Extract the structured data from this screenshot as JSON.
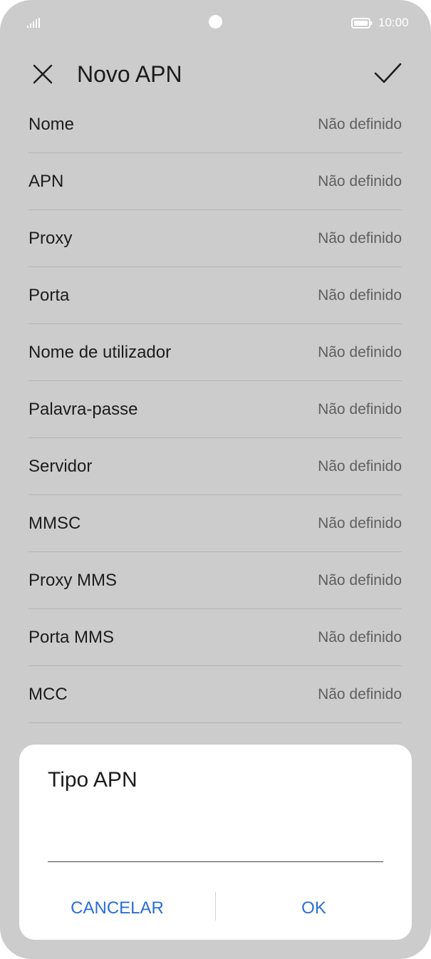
{
  "status_bar": {
    "time": "10:00",
    "signal_icon": "signal-icon",
    "battery_icon": "battery-icon"
  },
  "header": {
    "title": "Novo APN",
    "close_icon": "close-icon",
    "confirm_icon": "check-icon"
  },
  "fields": [
    {
      "label": "Nome",
      "value": "Não definido"
    },
    {
      "label": "APN",
      "value": "Não definido"
    },
    {
      "label": "Proxy",
      "value": "Não definido"
    },
    {
      "label": "Porta",
      "value": "Não definido"
    },
    {
      "label": "Nome de utilizador",
      "value": "Não definido"
    },
    {
      "label": "Palavra-passe",
      "value": "Não definido"
    },
    {
      "label": "Servidor",
      "value": "Não definido"
    },
    {
      "label": "MMSC",
      "value": "Não definido"
    },
    {
      "label": "Proxy MMS",
      "value": "Não definido"
    },
    {
      "label": "Porta MMS",
      "value": "Não definido"
    },
    {
      "label": "MCC",
      "value": "Não definido"
    }
  ],
  "dialog": {
    "title": "Tipo APN",
    "input_value": "",
    "cancel_label": "CANCELAR",
    "ok_label": "OK"
  },
  "colors": {
    "background_dim": "#cccccc",
    "accent": "#2a6ed8",
    "dialog_bg": "#ffffff"
  }
}
